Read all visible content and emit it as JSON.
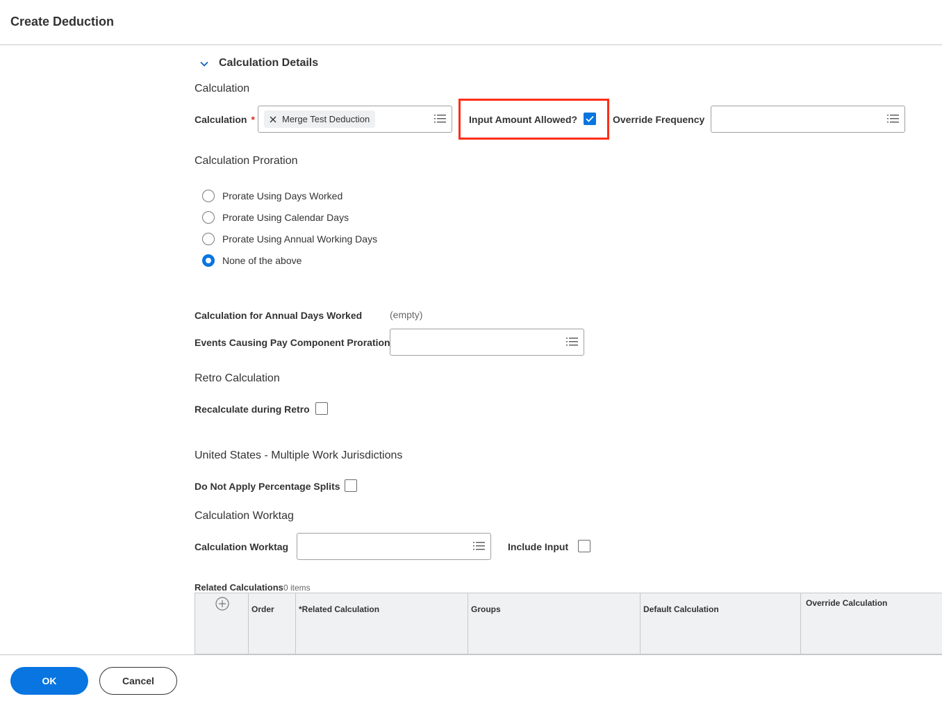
{
  "header": {
    "title": "Create Deduction"
  },
  "section": {
    "title": "Calculation Details"
  },
  "calculation_group": {
    "heading": "Calculation",
    "calculation_label": "Calculation",
    "required_marker": "*",
    "calculation_chip": "Merge Test Deduction",
    "input_amount_label": "Input Amount Allowed?",
    "input_amount_checked": true,
    "override_frequency_label": "Override Frequency"
  },
  "proration": {
    "heading": "Calculation Proration",
    "options": [
      {
        "label": "Prorate Using Days Worked",
        "selected": false
      },
      {
        "label": "Prorate Using Calendar Days",
        "selected": false
      },
      {
        "label": "Prorate Using Annual Working Days",
        "selected": false
      },
      {
        "label": "None of the above",
        "selected": true
      }
    ],
    "annual_days_label": "Calculation for Annual Days Worked",
    "annual_days_value": "(empty)",
    "events_label": "Events Causing Pay Component Proration"
  },
  "retro": {
    "heading": "Retro Calculation",
    "recalculate_label": "Recalculate during Retro",
    "recalculate_checked": false
  },
  "jurisdictions": {
    "heading": "United States - Multiple Work Jurisdictions",
    "no_splits_label": "Do Not Apply Percentage Splits",
    "no_splits_checked": false
  },
  "worktag": {
    "heading": "Calculation Worktag",
    "worktag_label": "Calculation Worktag",
    "include_input_label": "Include Input",
    "include_input_checked": false
  },
  "related": {
    "caption": "Related Calculations",
    "count": "0 items",
    "columns": [
      "Order",
      "*Related Calculation",
      "Groups",
      "Default Calculation",
      "Override Calculation"
    ]
  },
  "footer": {
    "ok_label": "OK",
    "cancel_label": "Cancel"
  },
  "colors": {
    "accent": "#0875e1",
    "highlight": "#ff2d16",
    "required": "#de2e21"
  }
}
